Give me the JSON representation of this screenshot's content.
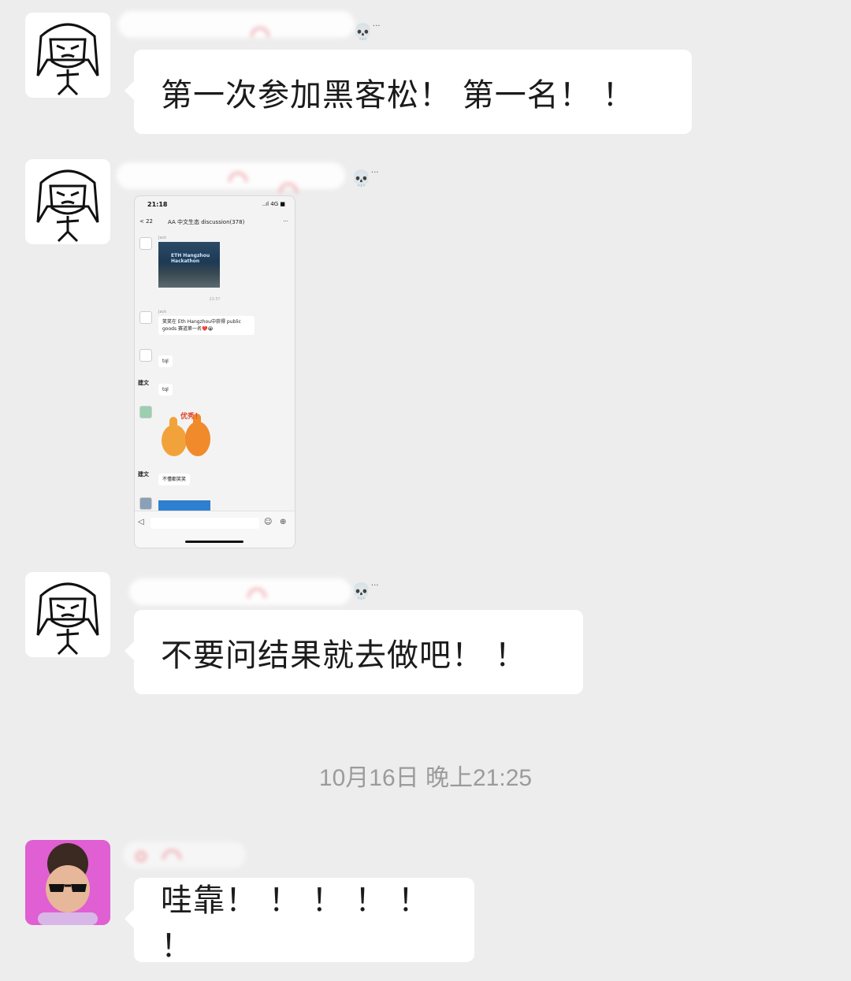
{
  "messages": [
    {
      "sender_icon": "cartoon-girl-avatar",
      "text": "第一次参加黑客松！ 第一名！ ！"
    },
    {
      "sender_icon": "cartoon-girl-avatar",
      "type": "image"
    },
    {
      "sender_icon": "cartoon-girl-avatar",
      "text": "不要问结果就去做吧！ ！"
    },
    {
      "sender_icon": "sunglasses-man-avatar",
      "text": "哇靠！ ！ ！ ！ ！ ！"
    }
  ],
  "timestamp": "10月16日 晚上21:25",
  "name_badge": "💀",
  "name_badge_more": "···",
  "screenshot": {
    "time": "21:18",
    "signal": "..ıl 4G ■",
    "back": "< 22",
    "title": "AA 中文生态 discussion(378)",
    "more": "···",
    "photo_text": "ETH Hangzhou Hackathon",
    "msg_time": "22:5?",
    "msg1": "笑笑在 Eth Hangzhou中获得 public goods 赛道第一名❤️😭",
    "msg2": "tql",
    "msg3": "tql",
    "sticker_text": "优秀！",
    "msg4": "不懂都笑笑",
    "names": {
      "n1": "Jack",
      "n2": "Jack",
      "n3": "建文",
      "n4": "建文"
    }
  },
  "colors": {
    "background": "#ededed",
    "bubble": "#ffffff",
    "timestamp": "#9b9b9b"
  }
}
